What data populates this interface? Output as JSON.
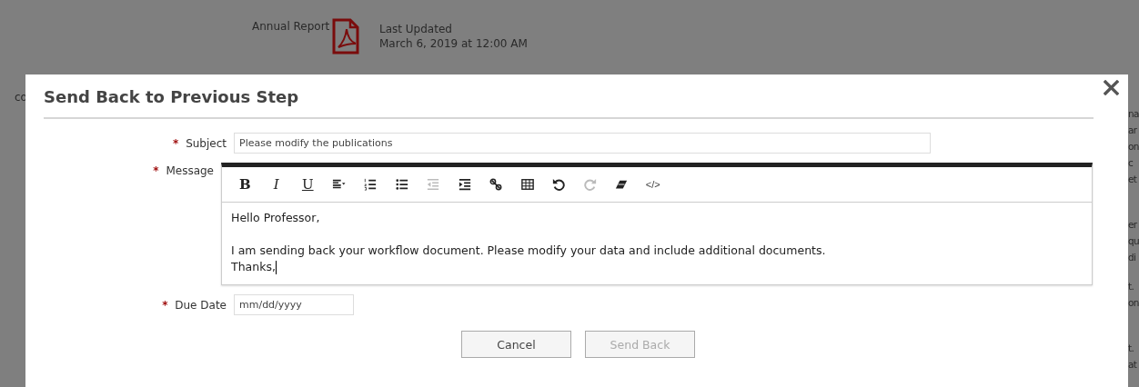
{
  "background_page": {
    "document_label": "Annual Report",
    "updated_label": "Last Updated",
    "updated_date": "March 6, 2019 at 12:00 AM",
    "left_fragment": "co",
    "right_fragments": [
      [
        "na",
        "ar",
        "on",
        "c",
        "et"
      ],
      [
        "er",
        "qu",
        "di"
      ],
      [
        "t.",
        "on"
      ],
      [
        "t.",
        "at"
      ]
    ]
  },
  "dialog": {
    "title": "Send Back to Previous Step",
    "subject": {
      "label": "Subject",
      "required_mark": "*",
      "value": "Please modify the publications"
    },
    "message": {
      "label": "Message",
      "required_mark": "*",
      "toolbar": [
        {
          "kind": "bold",
          "label": "B",
          "disabled": false
        },
        {
          "kind": "italic",
          "label": "I",
          "disabled": false
        },
        {
          "kind": "underline",
          "label": "U",
          "disabled": false
        },
        {
          "kind": "align",
          "disabled": false
        },
        {
          "kind": "ordered-list",
          "disabled": false
        },
        {
          "kind": "bullet-list",
          "disabled": false
        },
        {
          "kind": "outdent",
          "disabled": true
        },
        {
          "kind": "indent",
          "disabled": false
        },
        {
          "kind": "link",
          "disabled": false
        },
        {
          "kind": "table",
          "disabled": false
        },
        {
          "kind": "undo",
          "disabled": false
        },
        {
          "kind": "redo",
          "disabled": true
        },
        {
          "kind": "eraser",
          "disabled": false
        },
        {
          "kind": "code",
          "label": "</>",
          "disabled": false
        }
      ],
      "paragraphs": [
        [
          "Hello Professor,"
        ],
        [
          "I am sending back your workflow document. Please modify your data and include additional documents.",
          "Thanks,"
        ]
      ]
    },
    "due_date": {
      "label": "Due Date",
      "required_mark": "*",
      "placeholder": "mm/dd/yyyy"
    },
    "buttons": [
      {
        "label": "Cancel",
        "disabled": false
      },
      {
        "label": "Send Back",
        "disabled": true
      }
    ]
  }
}
